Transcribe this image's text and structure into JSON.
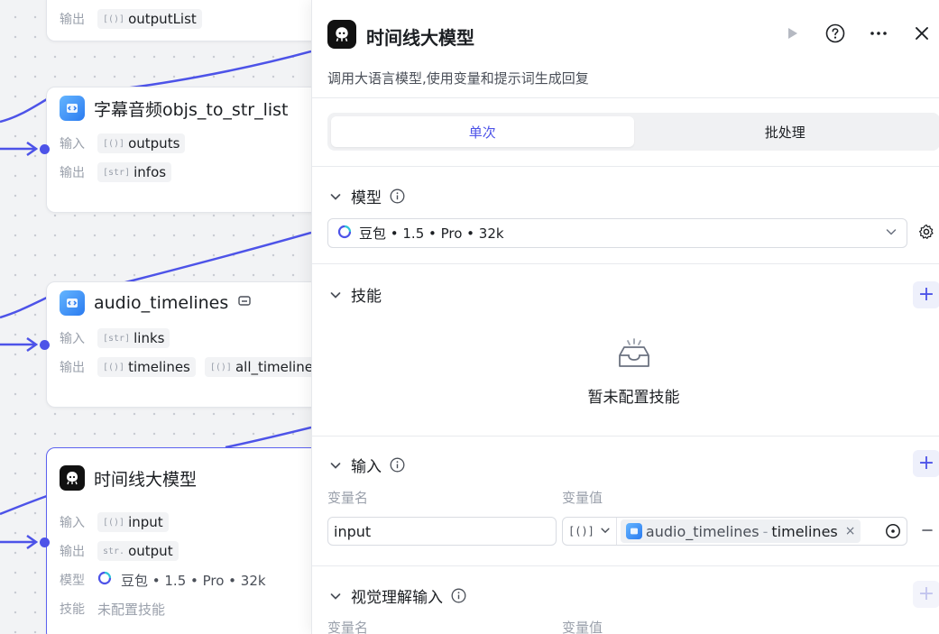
{
  "canvas": {
    "node_top": {
      "output_label": "输出",
      "output_type": "[()]",
      "output_value": "outputList"
    },
    "node_subtitle": {
      "title": "字幕音频objs_to_str_list",
      "input_label": "输入",
      "input_type": "[()]",
      "input_value": "outputs",
      "output_label": "输出",
      "output_type": "[str]",
      "output_value": "infos"
    },
    "node_audio": {
      "title": "audio_timelines",
      "input_label": "输入",
      "input_type": "[str]",
      "input_value": "links",
      "output_label": "输出",
      "output_type_1": "[()]",
      "output_value_1": "timelines",
      "output_type_2": "[()]",
      "output_value_2": "all_timelines"
    },
    "node_llm": {
      "title": "时间线大模型",
      "input_label": "输入",
      "input_type": "[()]",
      "input_value": "input",
      "output_label": "输出",
      "output_type": "str.",
      "output_value": "output",
      "model_label": "模型",
      "model_value": "豆包 • 1.5 • Pro • 32k",
      "skill_label": "技能",
      "skill_value": "未配置技能"
    }
  },
  "panel": {
    "title": "时间线大模型",
    "description": "调用大语言模型,使用变量和提示词生成回复",
    "tabs": [
      {
        "label": "单次",
        "active": true
      },
      {
        "label": "批处理",
        "active": false
      }
    ],
    "model_section": {
      "title": "模型",
      "selected": "豆包 • 1.5 • Pro • 32k"
    },
    "skills_section": {
      "title": "技能",
      "empty_text": "暂未配置技能"
    },
    "input_section": {
      "title": "输入",
      "col_name": "变量名",
      "col_value": "变量值",
      "row": {
        "name": "input",
        "type": "[()]",
        "ref_node": "audio_timelines",
        "ref_separator": "-",
        "ref_var": "timelines",
        "clear": "×"
      }
    },
    "vision_section": {
      "title": "视觉理解输入",
      "col_name": "变量名",
      "col_value": "变量值"
    }
  },
  "colors": {
    "accent": "#4d53e8",
    "edge": "#4d53e8",
    "muted": "#9aa0ab"
  },
  "icons": {
    "run": "play-icon",
    "help": "question-circle-icon",
    "more": "more-horizontal-icon",
    "close": "close-icon",
    "collapse": "chevron-down-icon",
    "info": "info-circle-icon",
    "settings": "gear-icon",
    "add": "plus-icon",
    "remove": "minus-icon",
    "empty": "empty-box-icon",
    "target": "target-icon"
  }
}
